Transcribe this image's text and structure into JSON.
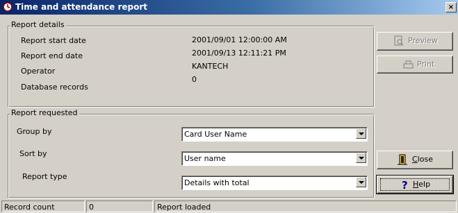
{
  "window": {
    "title": "Time and attendance report",
    "icon": "clock-icon",
    "close_glyph": "×"
  },
  "report_details": {
    "legend": "Report details",
    "rows": [
      {
        "label": "Report start date",
        "value": "2001/09/01 12:00:00 AM"
      },
      {
        "label": "Report end date",
        "value": "2001/09/13 12:11:21 PM"
      },
      {
        "label": "Operator",
        "value": "KANTECH"
      },
      {
        "label": "Database records",
        "value": "0"
      }
    ]
  },
  "report_requested": {
    "legend": "Report requested",
    "group_by": {
      "label": "Group by",
      "value": "Card User Name"
    },
    "sort_by": {
      "label": "Sort by",
      "value": "User name"
    },
    "report_type": {
      "label": "Report type",
      "value": "Details with total"
    }
  },
  "buttons": {
    "preview": {
      "label": "Preview",
      "icon": "preview-icon",
      "enabled": false
    },
    "print": {
      "label": "Print",
      "icon": "printer-icon",
      "enabled": false
    },
    "close": {
      "label_mnemonic": "C",
      "label_rest": "lose",
      "icon": "door-icon",
      "enabled": true
    },
    "help": {
      "label_mnemonic": "H",
      "label_rest": "elp",
      "icon": "question-mark-icon",
      "enabled": true
    }
  },
  "status_bar": {
    "label": "Record count",
    "count": "0",
    "message": "Report loaded"
  },
  "colors": {
    "title_start": "#0a246a",
    "title_end": "#a6caf0",
    "face": "#d4d0c8"
  }
}
